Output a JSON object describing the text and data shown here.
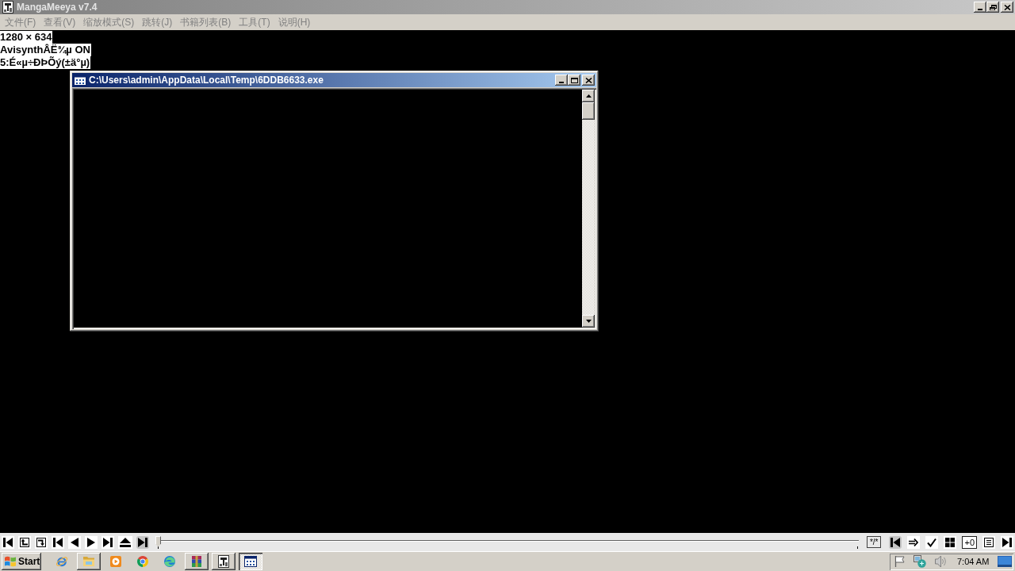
{
  "window": {
    "title": "MangaMeeya v7.4",
    "active": false
  },
  "menu": [
    {
      "label": "文件(F)",
      "disabled": true
    },
    {
      "label": "查看(V)",
      "disabled": true
    },
    {
      "label": "缩放模式(S)",
      "disabled": true
    },
    {
      "label": "跳转(J)",
      "disabled": true
    },
    {
      "label": "书籍列表(B)",
      "disabled": true
    },
    {
      "label": "工具(T)",
      "disabled": true
    },
    {
      "label": "说明(H)",
      "disabled": true
    }
  ],
  "overlay_lines": [
    "1280 × 634",
    "AvisynthÂË¾µ ON",
    "5:É«µ÷ÐÞÕý(±ä°µ)"
  ],
  "console_window": {
    "title": "C:\\Users\\admin\\AppData\\Local\\Temp\\6DDB6633.exe",
    "active": true
  },
  "toolbar": {
    "left_buttons": [
      {
        "pressed": false
      },
      {
        "pressed": false
      },
      {
        "pressed": false
      },
      {
        "pressed": false
      },
      {
        "pressed": false
      },
      {
        "pressed": false
      },
      {
        "pressed": false
      },
      {
        "pressed": false
      },
      {
        "pressed": true
      }
    ],
    "seek_bar": {
      "level": 0
    },
    "page_counter": "*/*",
    "right_buttons": [
      {
        "kind": "icon",
        "pressed": true
      },
      {
        "kind": "icon",
        "pressed": false
      },
      {
        "kind": "icon",
        "pressed": false
      },
      {
        "kind": "icon",
        "pressed": false
      },
      {
        "kind": "text",
        "label": "+0",
        "pressed": false
      },
      {
        "kind": "icon",
        "pressed": false
      },
      {
        "kind": "icon",
        "pressed": false
      }
    ]
  },
  "taskbar": {
    "start_label": "Start",
    "quick_launch": [
      {
        "raised": false
      },
      {
        "raised": true
      },
      {
        "raised": false
      },
      {
        "raised": false
      },
      {
        "raised": false
      }
    ],
    "windows": [
      {
        "selected": false
      },
      {
        "selected": false
      },
      {
        "selected": true
      }
    ],
    "clock": "7:04 AM"
  }
}
